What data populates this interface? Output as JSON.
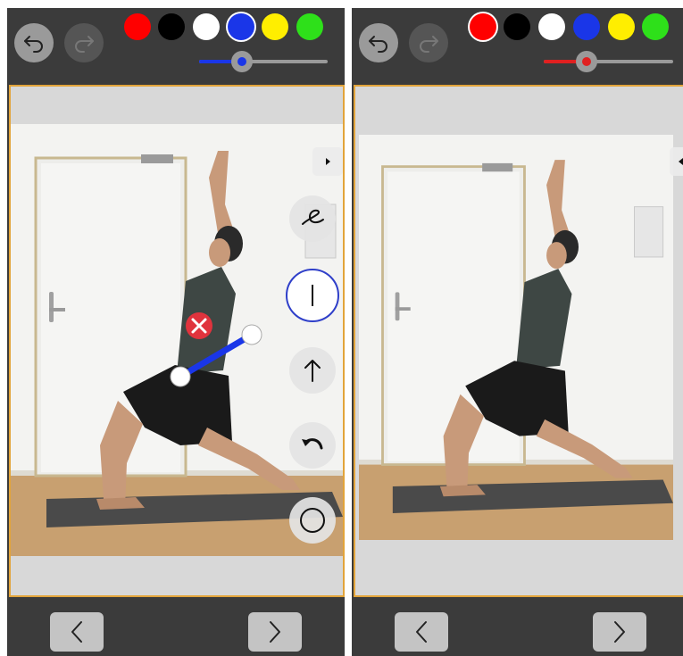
{
  "colors": {
    "palette": [
      "#ff0000",
      "#000000",
      "#ffffff",
      "#1a36e8",
      "#ffee00",
      "#2ee01a"
    ],
    "frame_border": "#e2a43a",
    "line_color": "#1a36e8",
    "delete_color": "#e0333d"
  },
  "left_screen": {
    "selected_color_index": 3,
    "stroke_width_level": 0.33,
    "stroke_color": "#1a36e8",
    "tools": [
      {
        "name": "freehand",
        "icon": "loop-scribble-icon"
      },
      {
        "name": "line",
        "icon": "vertical-line-icon",
        "active": true
      },
      {
        "name": "arrow",
        "icon": "up-arrow-icon"
      },
      {
        "name": "undo-stroke",
        "icon": "curved-undo-icon"
      },
      {
        "name": "circle",
        "icon": "circle-outline-icon"
      }
    ],
    "tools_panel": "expanded"
  },
  "right_screen": {
    "selected_color_index": 0,
    "stroke_width_level": 0.33,
    "stroke_color": "#e02020",
    "tools_panel": "collapsed"
  },
  "icons": {
    "undo": "undo-arrow-icon",
    "redo": "redo-arrow-icon",
    "prev": "chevron-left-icon",
    "next": "chevron-right-icon"
  }
}
